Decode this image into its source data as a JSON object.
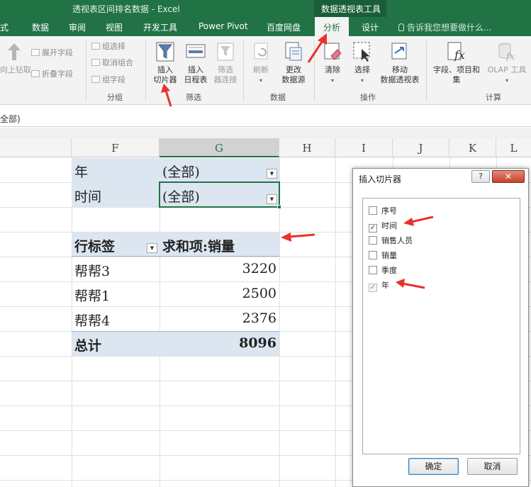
{
  "window": {
    "title": "透视表区间排名数据 - Excel",
    "context_tab_group": "数据透视表工具"
  },
  "tabs": [
    "式",
    "数据",
    "审阅",
    "视图",
    "开发工具",
    "Power Pivot",
    "百度网盘",
    "分析",
    "设计"
  ],
  "active_tab": "分析",
  "tell_me": "告诉我您想要做什么...",
  "ribbon": {
    "active_field_cut": "向上钻取",
    "expand_field": "展开字段",
    "collapse_field": "折叠字段",
    "group_selection": "组选择",
    "ungroup": "取消组合",
    "group_field": "组字段",
    "group_label": "分组",
    "insert_slicer": "插入\n切片器",
    "insert_timeline": "插入\n日程表",
    "filter_connections": "筛选\n器连接",
    "filter_label": "筛选",
    "refresh": "刷新",
    "change_source": "更改\n数据源",
    "data_label": "数据",
    "clear": "清除",
    "select": "选择",
    "move_pivot": "移动\n数据透视表",
    "actions_label": "操作",
    "fields_items": "字段、项目和\n集",
    "olap_tools": "OLAP 工具",
    "calc_label": "计算"
  },
  "formula_bar": {
    "content": "全部)"
  },
  "columns": [
    "F",
    "G",
    "H",
    "I",
    "J",
    "K",
    "L"
  ],
  "pivot": {
    "filters": [
      {
        "label": "年",
        "value": "(全部)"
      },
      {
        "label": "时间",
        "value": "(全部)"
      }
    ],
    "header_row_label": "行标签",
    "header_value": "求和项:销量",
    "rows": [
      {
        "label": "帮帮3",
        "value": "3220"
      },
      {
        "label": "帮帮1",
        "value": "2500"
      },
      {
        "label": "帮帮4",
        "value": "2376"
      }
    ],
    "total_label": "总计",
    "total_value": "8096"
  },
  "dialog": {
    "title": "插入切片器",
    "help": "?",
    "close": "✕",
    "fields": [
      {
        "label": "序号",
        "checked": false
      },
      {
        "label": "时间",
        "checked": true
      },
      {
        "label": "销售人员",
        "checked": false
      },
      {
        "label": "销量",
        "checked": false
      },
      {
        "label": "季度",
        "checked": false
      },
      {
        "label": "年",
        "checked": true
      }
    ],
    "ok": "确定",
    "cancel": "取消"
  },
  "colors": {
    "excel_green": "#217346",
    "pivot_band": "#dce6f1",
    "annotation_red": "#e8322b"
  }
}
